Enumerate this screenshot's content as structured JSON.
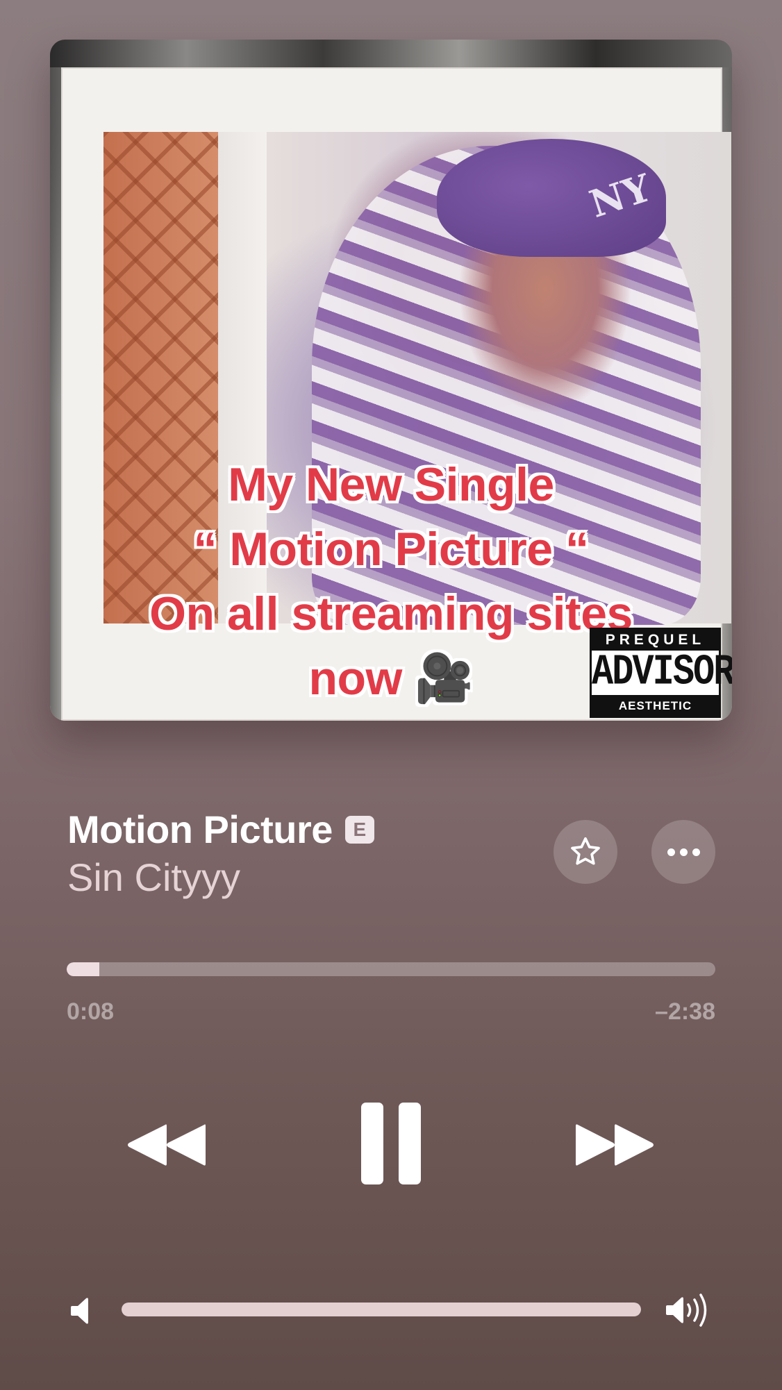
{
  "album_art": {
    "overlay_lines": [
      "My New Single",
      "“ Motion  Picture “",
      "On all streaming sites",
      "now 🎥"
    ],
    "cap_logo": "NY",
    "advisory": {
      "top": "PREQUEL",
      "middle": "ADVISORY",
      "bottom": "AESTHETIC CONTENT"
    }
  },
  "track": {
    "title": "Motion Picture",
    "explicit_badge": "E",
    "artist": "Sin Cityyy"
  },
  "playback": {
    "elapsed": "0:08",
    "remaining": "–2:38",
    "progress_fraction": 0.05
  },
  "volume": {
    "level_fraction": 1.0
  },
  "icons": {
    "favorite": "star-icon",
    "more": "ellipsis-icon",
    "rewind": "rewind-icon",
    "pause": "pause-icon",
    "forward": "fast-forward-icon",
    "volume_low": "speaker-low-icon",
    "volume_high": "speaker-high-icon"
  },
  "colors": {
    "background_top": "#8c7d80",
    "background_bottom": "#5f4b48",
    "overlay_text": "#e23b48",
    "scrubber_fill": "#efdee1"
  }
}
